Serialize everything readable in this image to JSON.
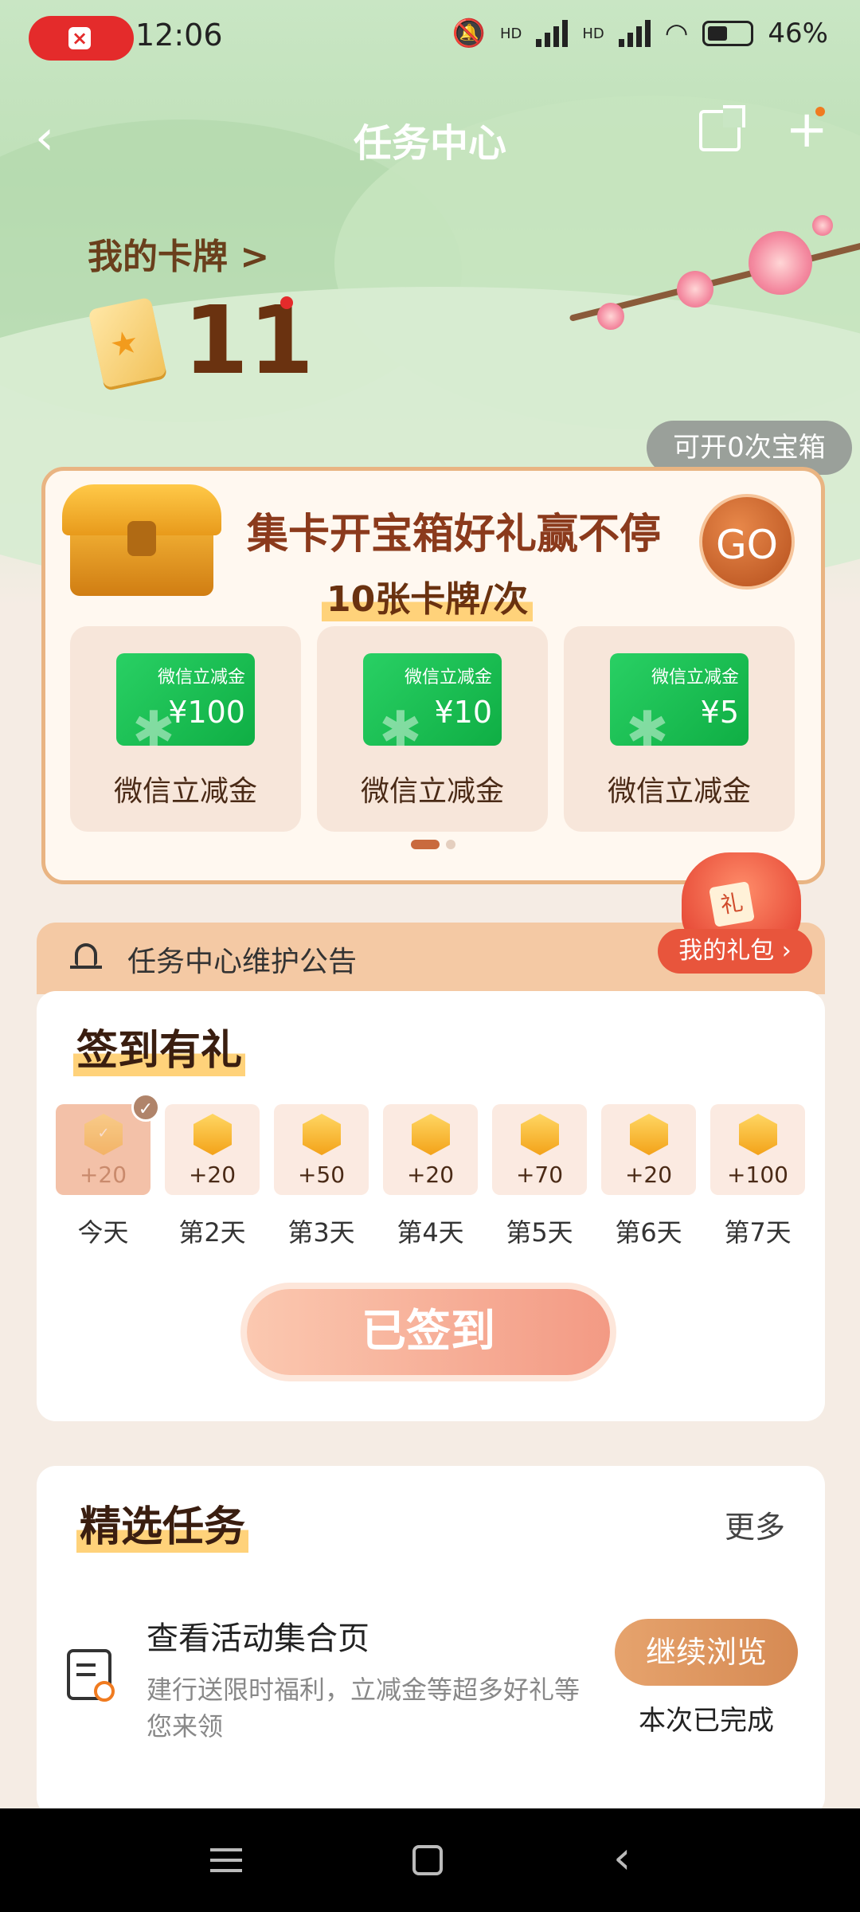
{
  "status": {
    "time": "12:06",
    "battery": "46%",
    "hd1": "HD",
    "hd2": "HD"
  },
  "nav": {
    "title": "任务中心",
    "back": "‹",
    "plus": "+"
  },
  "cards": {
    "link_label": "我的卡牌 >",
    "count": "11"
  },
  "chest": {
    "tip": "可开0次宝箱",
    "title": "集卡开宝箱好礼赢不停",
    "subtitle": "10张卡牌/次",
    "go": "GO",
    "rewards": [
      {
        "card_label": "微信立减金",
        "amount": "¥100",
        "name": "微信立减金"
      },
      {
        "card_label": "微信立减金",
        "amount": "¥10",
        "name": "微信立减金"
      },
      {
        "card_label": "微信立减金",
        "amount": "¥5",
        "name": "微信立减金"
      }
    ],
    "gift_tag": "礼"
  },
  "notice": {
    "text": "任务中心维护公告",
    "my_gift": "我的礼包 ›"
  },
  "signin": {
    "title": "签到有礼",
    "days": [
      {
        "label": "今天",
        "points": "+20",
        "done": true
      },
      {
        "label": "第2天",
        "points": "+20"
      },
      {
        "label": "第3天",
        "points": "+50"
      },
      {
        "label": "第4天",
        "points": "+20"
      },
      {
        "label": "第5天",
        "points": "+70"
      },
      {
        "label": "第6天",
        "points": "+20"
      },
      {
        "label": "第7天",
        "points": "+100"
      }
    ],
    "button": "已签到"
  },
  "tasks": {
    "title": "精选任务",
    "more": "更多",
    "items": [
      {
        "title": "查看活动集合页",
        "desc": "建行送限时福利，立减金等超多好礼等您来领",
        "button": "继续浏览",
        "status": "本次已完成"
      }
    ]
  }
}
